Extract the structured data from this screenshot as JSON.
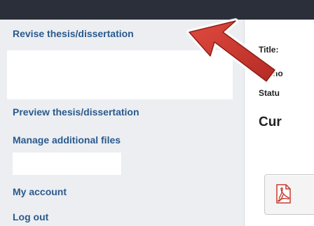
{
  "sidebar": {
    "items": [
      {
        "label": "Revise thesis/dissertation"
      },
      {
        "label": "Preview thesis/dissertation"
      },
      {
        "label": "Manage additional files"
      },
      {
        "label": "My account"
      },
      {
        "label": "Log out"
      }
    ]
  },
  "details": {
    "title_label": "Title:",
    "author_label": "Autho",
    "status_label": "Statu"
  },
  "main": {
    "section_heading": "Cur"
  },
  "icons": {
    "pdf": "pdf-icon",
    "annotation": "red-arrow-annotation"
  },
  "colors": {
    "topbar": "#2b2f3a",
    "sidebar_bg": "#eceef1",
    "link": "#2a5a8e",
    "arrow": "#d03a32"
  }
}
